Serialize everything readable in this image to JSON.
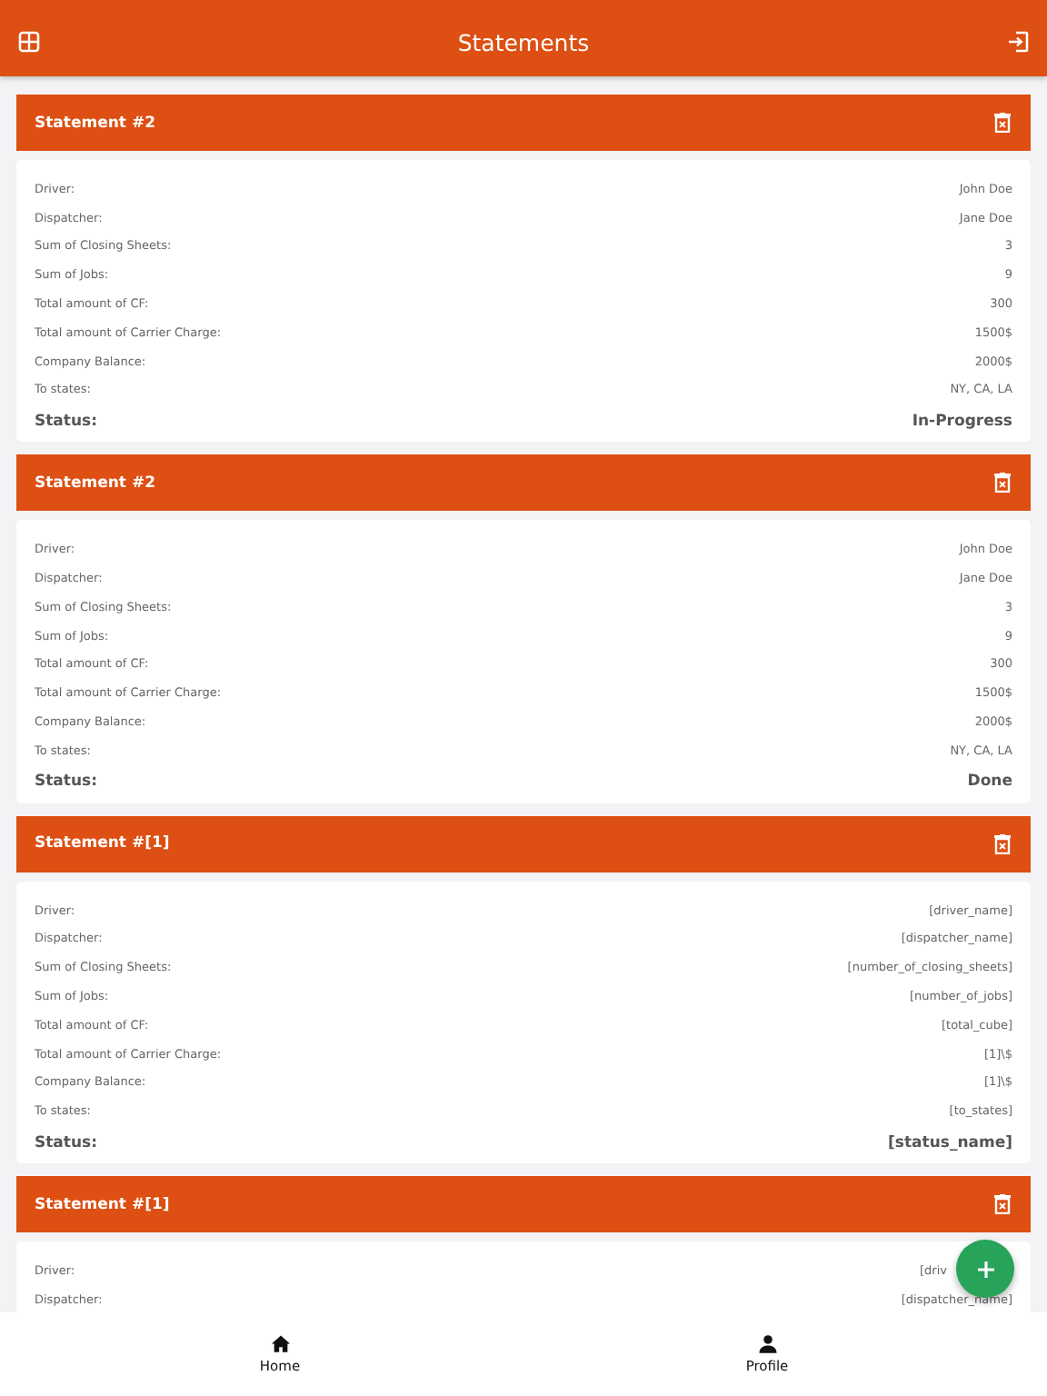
{
  "app_bar": {
    "title": "Statements"
  },
  "statements": [
    {
      "title": "Statement #2",
      "fields": [
        {
          "label": "Driver:",
          "value": "John Doe"
        },
        {
          "label": "Dispatcher:",
          "value": "Jane Doe"
        },
        {
          "label": "Sum of Closing Sheets:",
          "value": "3"
        },
        {
          "label": "Sum of Jobs:",
          "value": "9"
        },
        {
          "label": "Total amount of CF:",
          "value": "300"
        },
        {
          "label": "Total amount of Carrier Charge:",
          "value": "1500$"
        },
        {
          "label": "Company Balance:",
          "value": "2000$"
        },
        {
          "label": "To states:",
          "value": "NY, CA, LA"
        }
      ],
      "status_label": "Status:",
      "status": "In-Progress"
    },
    {
      "title": "Statement #2",
      "fields": [
        {
          "label": "Driver:",
          "value": "John Doe"
        },
        {
          "label": "Dispatcher:",
          "value": "Jane Doe"
        },
        {
          "label": "Sum of Closing Sheets:",
          "value": "3"
        },
        {
          "label": "Sum of Jobs:",
          "value": "9"
        },
        {
          "label": "Total amount of CF:",
          "value": "300"
        },
        {
          "label": "Total amount of Carrier Charge:",
          "value": "1500$"
        },
        {
          "label": "Company Balance:",
          "value": "2000$"
        },
        {
          "label": "To states:",
          "value": "NY, CA, LA"
        }
      ],
      "status_label": "Status:",
      "status": "Done"
    },
    {
      "title": "Statement #[1]",
      "fields": [
        {
          "label": "Driver:",
          "value": "[driver_name]"
        },
        {
          "label": "Dispatcher:",
          "value": "[dispatcher_name]"
        },
        {
          "label": "Sum of Closing Sheets:",
          "value": "[number_of_closing_sheets]"
        },
        {
          "label": "Sum of Jobs:",
          "value": "[number_of_jobs]"
        },
        {
          "label": "Total amount of CF:",
          "value": "[total_cube]"
        },
        {
          "label": "Total amount of Carrier Charge:",
          "value": "[1]\\$"
        },
        {
          "label": "Company Balance:",
          "value": "[1]\\$"
        },
        {
          "label": "To states:",
          "value": "[to_states]"
        }
      ],
      "status_label": "Status:",
      "status": "[status_name]"
    },
    {
      "title": "Statement #[1]",
      "fields": [
        {
          "label": "Driver:",
          "value": "[driv"
        },
        {
          "label": "Dispatcher:",
          "value": "[dispatcher_name]"
        }
      ]
    }
  ],
  "bottom_nav": [
    {
      "label": "Home"
    },
    {
      "label": "Profile"
    }
  ]
}
